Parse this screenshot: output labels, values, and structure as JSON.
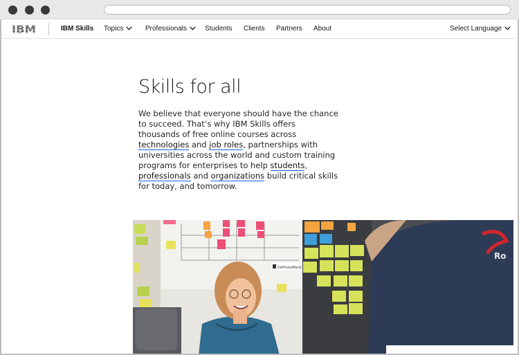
{
  "browser": {
    "window_controls": [
      "close-dot",
      "minimize-dot",
      "maximize-dot"
    ],
    "address_bar_text": ""
  },
  "nav": {
    "logo_text": "IBM",
    "brand": "IBM Skills",
    "items": [
      {
        "label": "Topics",
        "has_dropdown": true
      },
      {
        "label": "Professionals",
        "has_dropdown": true
      },
      {
        "label": "Students",
        "has_dropdown": false
      },
      {
        "label": "Clients",
        "has_dropdown": false
      },
      {
        "label": "Partners",
        "has_dropdown": false
      },
      {
        "label": "About",
        "has_dropdown": false
      }
    ],
    "language": "Select Language"
  },
  "hero": {
    "title": "Skills for all",
    "intro": {
      "t1": "We believe that everyone should have the chance to succeed. That’s why IBM Skills offers thousands of free online courses across ",
      "link_technologies": "technologies",
      "t2": " and ",
      "link_job_roles": "job roles",
      "t3": ", partnerships with universities across the world and custom training programs for enterprises to help ",
      "link_students": "students",
      "t4": ", ",
      "link_professionals": "professionals",
      "t5": " and ",
      "link_organizations": "organizations",
      "t6": " build critical skills for today, and tomorrow."
    },
    "photo": {
      "board_label": "DePhotoMach",
      "shirt_text": "Ro"
    }
  },
  "colors": {
    "link_underline": "#0f62fe",
    "text": "#161616",
    "shirt": "#2d3b57",
    "accent_red": "#d0262c"
  }
}
